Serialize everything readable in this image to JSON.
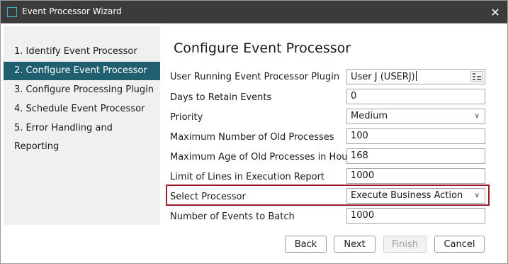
{
  "window": {
    "title": "Event Processor Wizard",
    "close_glyph": "✕"
  },
  "nav": {
    "items": [
      {
        "label": "1. Identify Event Processor",
        "active": false
      },
      {
        "label": "2. Configure Event Processor",
        "active": true
      },
      {
        "label": "3. Configure Processing Plugin",
        "active": false
      },
      {
        "label": "4. Schedule Event Processor",
        "active": false
      },
      {
        "label": "5. Error Handling and Reporting",
        "active": false
      }
    ]
  },
  "main": {
    "heading": "Configure Event Processor",
    "fields": {
      "user": {
        "label": "User Running Event Processor Plugin",
        "value": "User J (USERJ)",
        "picker_icon": "list-picker-icon"
      },
      "days": {
        "label": "Days to Retain Events",
        "value": "0"
      },
      "priority": {
        "label": "Priority",
        "value": "Medium"
      },
      "max_processes": {
        "label": "Maximum Number of Old Processes",
        "value": "100"
      },
      "max_age": {
        "label": "Maximum Age of Old Processes in Hours",
        "value": "168"
      },
      "limit_lines": {
        "label": "Limit of Lines in Execution Report",
        "value": "1000"
      },
      "processor": {
        "label": "Select Processor",
        "value": "Execute Business Action"
      },
      "batch": {
        "label": "Number of Events to Batch",
        "value": "1000"
      }
    }
  },
  "buttons": {
    "back": "Back",
    "next": "Next",
    "finish": "Finish",
    "cancel": "Cancel"
  },
  "colors": {
    "titlebar": "#3b3b3b",
    "nav_active": "#1f5f70",
    "highlight": "#9b1b2a"
  }
}
